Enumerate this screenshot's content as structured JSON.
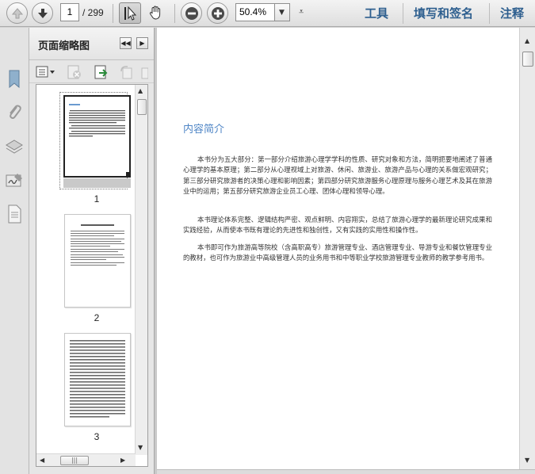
{
  "toolbar": {
    "page_current": "1",
    "page_total": "/ 299",
    "zoom_value": "50.4%",
    "links": [
      "工具",
      "填写和签名",
      "注释"
    ]
  },
  "panel": {
    "title": "页面缩略图",
    "thumbnails": [
      "1",
      "2",
      "3"
    ]
  },
  "document": {
    "heading": "内容简介",
    "paragraphs": [
      "本书分为五大部分：第一部分介绍旅游心理学学科的性质、研究对象和方法，简明扼要地阐述了普通心理学的基本原理；第二部分从心理视域上对旅游、休闲、旅游业、旅游产品与心理的关系做宏观研究；第三部分研究旅游者的决策心理和影响因素；第四部分研究旅游服务心理原理与服务心理艺术及其在旅游业中的运用；第五部分研究旅游企业员工心理、团体心理和领导心理。",
      "本书理论体系完整、逻辑结构严密、观点鲜明、内容翔实，总结了旅游心理学的最新理论研究成果和实践经验，从而使本书既有理论的先进性和独创性，又有实践的实用性和操作性。",
      "本书即可作为旅游高等院校（含高职高专）旅游管理专业、酒店管理专业、导游专业和餐饮管理专业的教材，也可作为旅游业中高级管理人员的业务用书和中等职业学校旅游管理专业教师的教学参考用书。"
    ]
  },
  "colors": {
    "heading_blue": "#4f86c6",
    "link_blue": "#2e5f8f"
  }
}
